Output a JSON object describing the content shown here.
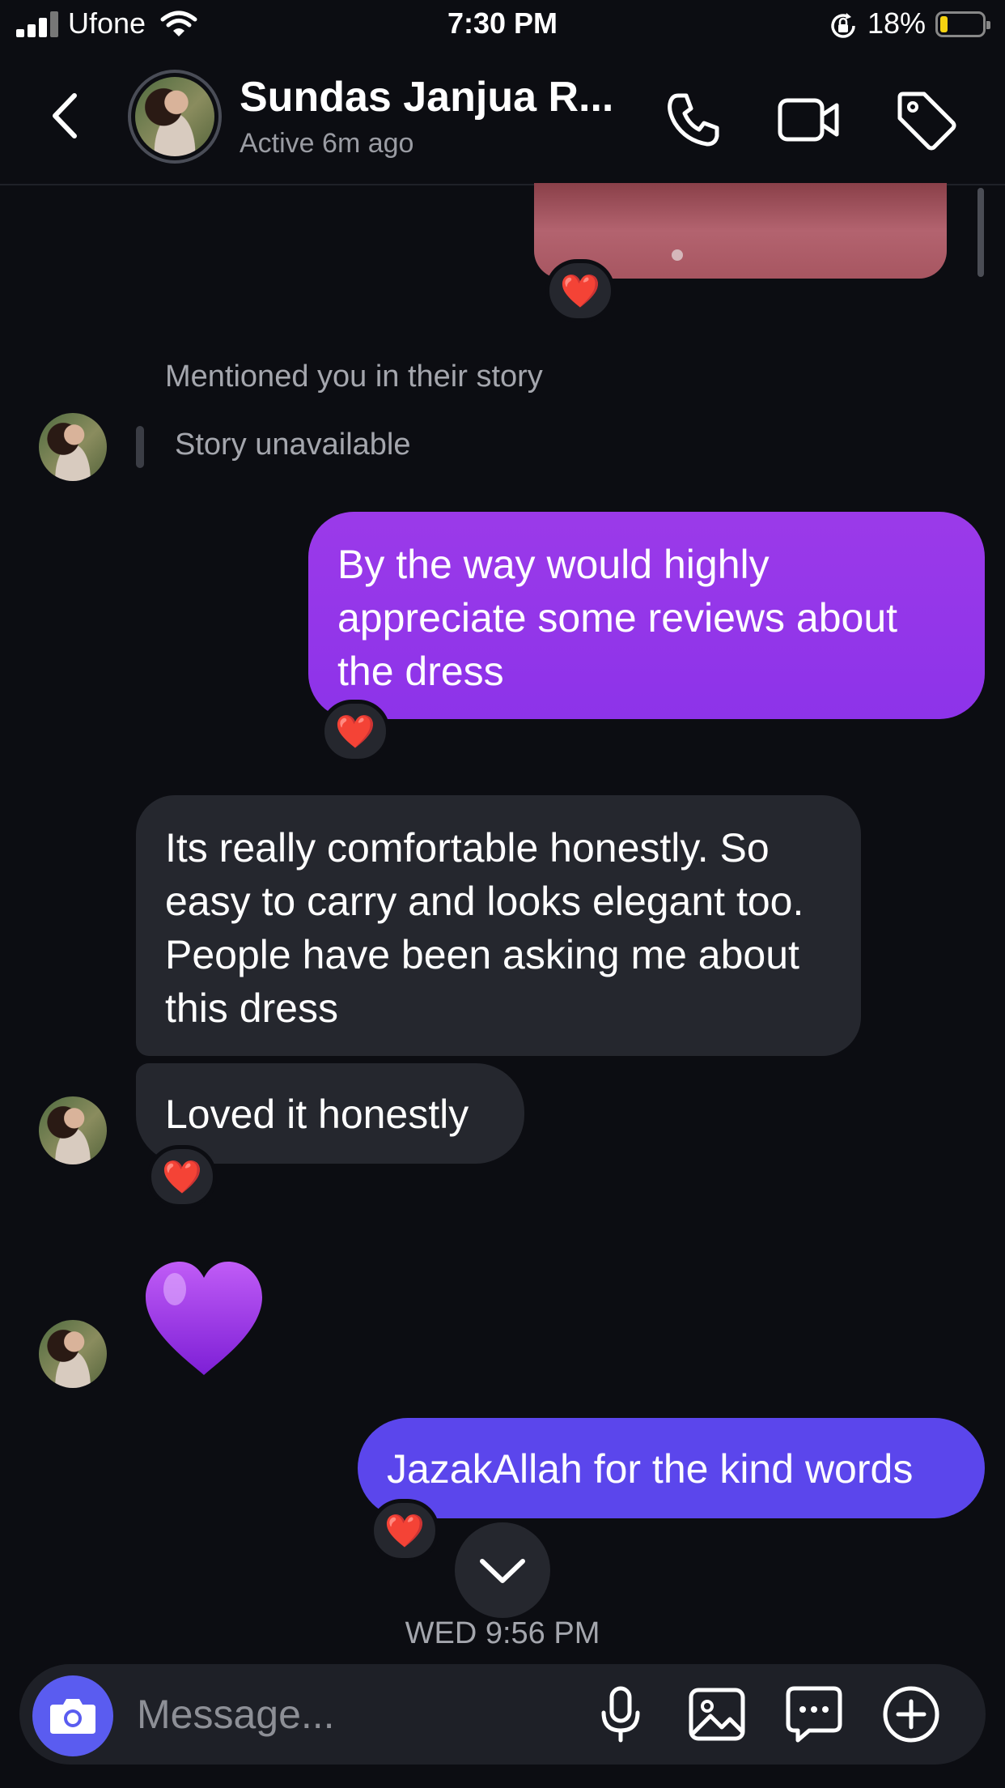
{
  "status_bar": {
    "carrier": "Ufone",
    "time": "7:30 PM",
    "battery": "18%"
  },
  "header": {
    "contact_name": "Sundas Janjua R...",
    "active_status": "Active 6m ago",
    "icons": [
      "back-chevron-icon",
      "phone-icon",
      "video-call-icon",
      "tag-icon"
    ]
  },
  "colors": {
    "background": "#0c0d12",
    "incoming_bubble": "#25272e",
    "outgoing_bubble_purple": "#9b3ae9",
    "outgoing_bubble_indigo": "#5b46ec",
    "heart_reaction": "#fe2b47",
    "camera_button": "#5a5cf0"
  },
  "messages": {
    "shared_image_reaction": "❤️",
    "story_mention": "Mentioned you in their story",
    "story_unavailable": "Story unavailable",
    "outgoing_1": {
      "text": "By the way would highly appreciate some reviews about the dress",
      "reaction": "❤️"
    },
    "incoming_1": {
      "text": "Its really comfortable honestly. So easy to carry and looks elegant too. People have been asking me about this dress"
    },
    "incoming_2": {
      "text": "Loved it honestly",
      "reaction": "❤️"
    },
    "incoming_3": {
      "emoji": "purple-heart"
    },
    "outgoing_2": {
      "text": "JazakAllah for the kind words",
      "reaction": "❤️"
    }
  },
  "timestamp": "WED 9:56 PM",
  "composer": {
    "placeholder": "Message...",
    "icons": [
      "camera-icon",
      "microphone-icon",
      "gallery-icon",
      "sticker-chat-icon",
      "add-icon"
    ]
  }
}
